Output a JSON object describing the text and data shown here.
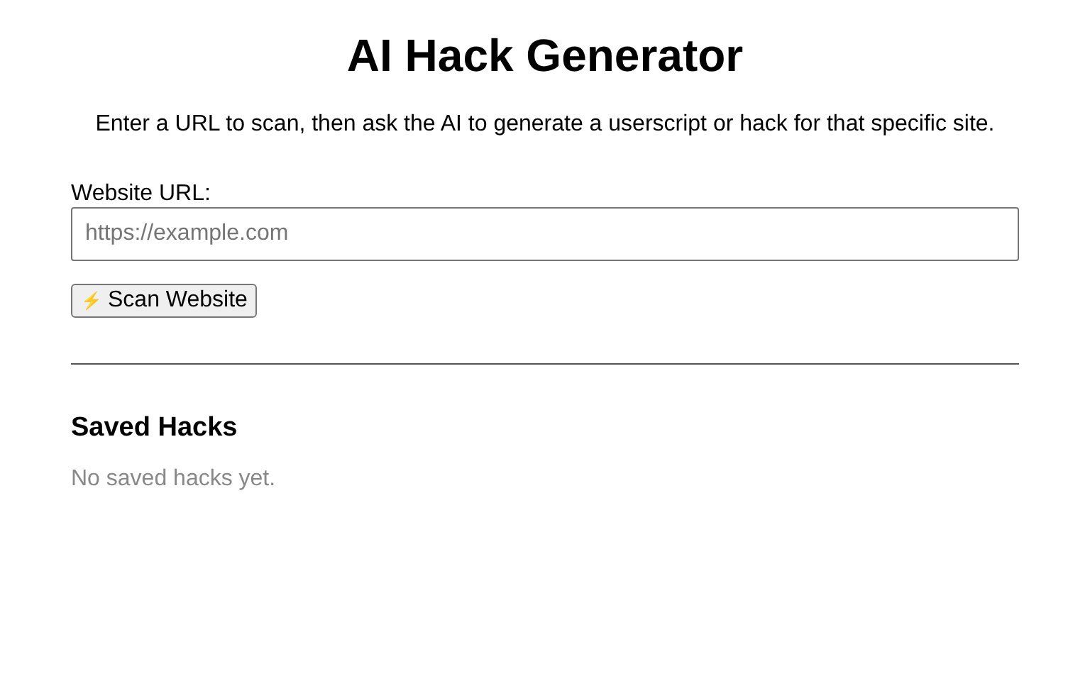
{
  "title": "AI Hack Generator",
  "description": "Enter a URL to scan, then ask the AI to generate a userscript or hack for that specific site.",
  "url_field": {
    "label": "Website URL:",
    "placeholder": "https://example.com"
  },
  "scan_button": {
    "icon": "⚡",
    "label": "Scan Website"
  },
  "saved": {
    "heading": "Saved Hacks",
    "empty": "No saved hacks yet."
  }
}
